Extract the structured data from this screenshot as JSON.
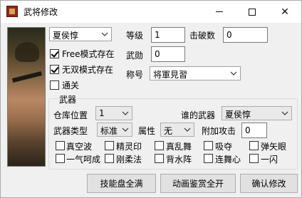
{
  "window": {
    "title": "武将修改"
  },
  "officer": {
    "name": "夏侯惇"
  },
  "stats": {
    "level_label": "等级",
    "level_value": "1",
    "defeat_label": "击破数",
    "defeat_value": "0",
    "merit_label": "武勋",
    "merit_value": "0",
    "title_label": "称号",
    "title_value": "将軍見習"
  },
  "modes": {
    "free_label": "Free模式存在",
    "free_checked": true,
    "musou_label": "无双模式存在",
    "musou_checked": true,
    "clear_label": "通关",
    "clear_checked": false
  },
  "weapon": {
    "group_title": "武器",
    "slot_label": "仓库位置",
    "slot_value": "1",
    "owner_label": "谁的武器",
    "owner_value": "夏侯惇",
    "type_label": "武器类型",
    "type_value": "标准",
    "attr_label": "属性",
    "attr_value": "无",
    "bonus_label": "附加攻击",
    "bonus_value": "0",
    "skills": [
      "真空波",
      "精灵印",
      "真乱舞",
      "吸夺",
      "弹矢眼",
      "一气呵成",
      "刚柔法",
      "背水阵",
      "连舞心",
      "一闪"
    ]
  },
  "buttons": {
    "skills_full": "技能盘全满",
    "anim_all": "动画鉴赏全开",
    "confirm": "确认修改"
  }
}
